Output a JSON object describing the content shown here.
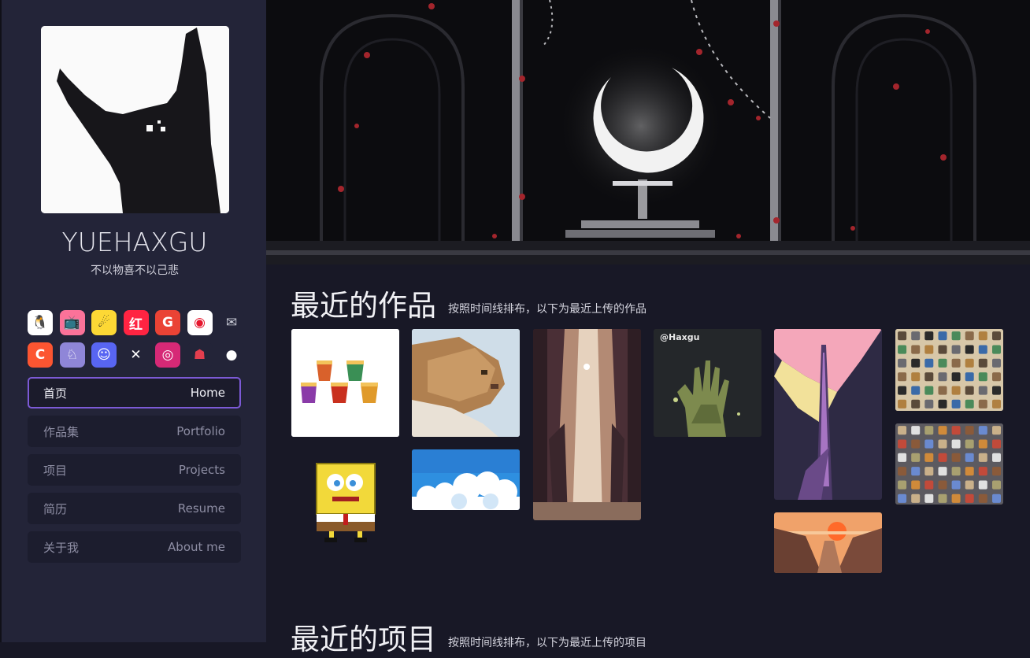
{
  "sidebar": {
    "name": "YUEHAXGU",
    "motto": "不以物喜不以己悲",
    "social": [
      {
        "icon": "qq-icon",
        "glyph": "🐧",
        "bg": "#ffffff",
        "fg": "#111111"
      },
      {
        "icon": "bilibili-icon",
        "glyph": "📺",
        "bg": "#fb7299",
        "fg": "#ffffff"
      },
      {
        "icon": "acfun-icon",
        "glyph": "☄",
        "bg": "#fdd835",
        "fg": "#222222"
      },
      {
        "icon": "xiaohongshu-icon",
        "glyph": "红",
        "bg": "#ff2442",
        "fg": "#ffffff"
      },
      {
        "icon": "google-icon",
        "glyph": "G",
        "bg": "#ea4335",
        "fg": "#ffffff"
      },
      {
        "icon": "weibo-icon",
        "glyph": "◉",
        "bg": "#ffffff",
        "fg": "#e6162d"
      },
      {
        "icon": "email-icon",
        "glyph": "✉",
        "bg": "#232438",
        "fg": "#c9cbd6"
      },
      {
        "icon": "csdn-icon",
        "glyph": "C",
        "bg": "#fc5531",
        "fg": "#ffffff"
      },
      {
        "icon": "lofter-icon",
        "glyph": "♘",
        "bg": "#8f86d8",
        "fg": "#ffffff"
      },
      {
        "icon": "discord-icon",
        "glyph": "☺",
        "bg": "#5865f2",
        "fg": "#ffffff"
      },
      {
        "icon": "x-twitter-icon",
        "glyph": "✕",
        "bg": "#232438",
        "fg": "#ffffff"
      },
      {
        "icon": "instagram-icon",
        "glyph": "◎",
        "bg": "#d62976",
        "fg": "#ffffff"
      },
      {
        "icon": "shop-icon",
        "glyph": "☗",
        "bg": "#232438",
        "fg": "#e33e4e"
      },
      {
        "icon": "github-icon",
        "glyph": "●",
        "bg": "#232438",
        "fg": "#ffffff"
      }
    ],
    "nav": [
      {
        "zh": "首页",
        "en": "Home",
        "active": true
      },
      {
        "zh": "作品集",
        "en": "Portfolio",
        "active": false
      },
      {
        "zh": "项目",
        "en": "Projects",
        "active": false
      },
      {
        "zh": "简历",
        "en": "Resume",
        "active": false
      },
      {
        "zh": "关于我",
        "en": "About me",
        "active": false
      }
    ]
  },
  "main": {
    "recent_works": {
      "title": "最近的作品",
      "subtitle": "按照时间线排布，以下为最近上传的作品",
      "thumbs": [
        {
          "name": "noodle-cups-art"
        },
        {
          "name": "spongebob-pixel-art"
        },
        {
          "name": "cat-pixel-art"
        },
        {
          "name": "sky-clouds-art"
        },
        {
          "name": "forest-light-art"
        },
        {
          "name": "zombie-hand-art",
          "label": "@Haxgu"
        },
        {
          "name": "tower-pink-sky-art"
        },
        {
          "name": "sunset-canyon-art"
        },
        {
          "name": "weapon-icons-sheet"
        },
        {
          "name": "item-icons-sheet"
        }
      ]
    },
    "recent_projects": {
      "title": "最近的项目",
      "subtitle": "按照时间线排布，以下为最近上传的项目"
    }
  }
}
